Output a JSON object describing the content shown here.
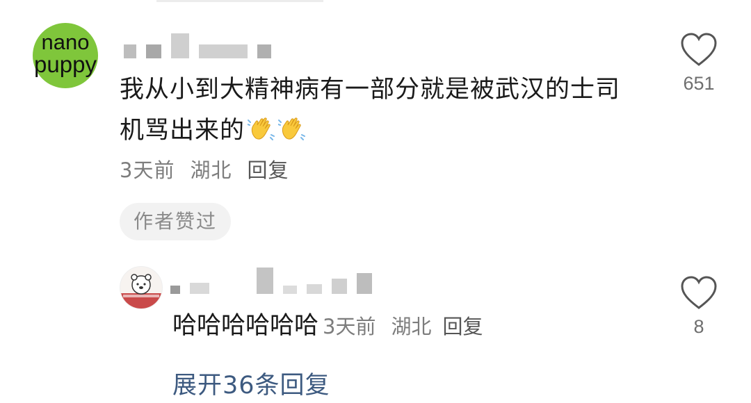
{
  "comment": {
    "avatar": {
      "line1": "nano",
      "line2": "puppy",
      "color": "#7fc63b"
    },
    "text": "我从小到大精神病有一部分就是被武汉的士司机骂出来的",
    "emoji": "waving-hand-icon",
    "time": "3天前",
    "location": "湖北",
    "reply_label": "回复",
    "badge": "作者赞过",
    "like_count": "651"
  },
  "reply": {
    "avatar_icon": "bear-sticker-avatar",
    "text": "哈哈哈哈哈哈",
    "time": "3天前",
    "location": "湖北",
    "reply_label": "回复",
    "like_count": "8"
  },
  "expand_label": "展开36条回复",
  "colors": {
    "link": "#3d5a80",
    "meta": "#7d7d7d",
    "badge_bg": "#f2f2f2"
  }
}
